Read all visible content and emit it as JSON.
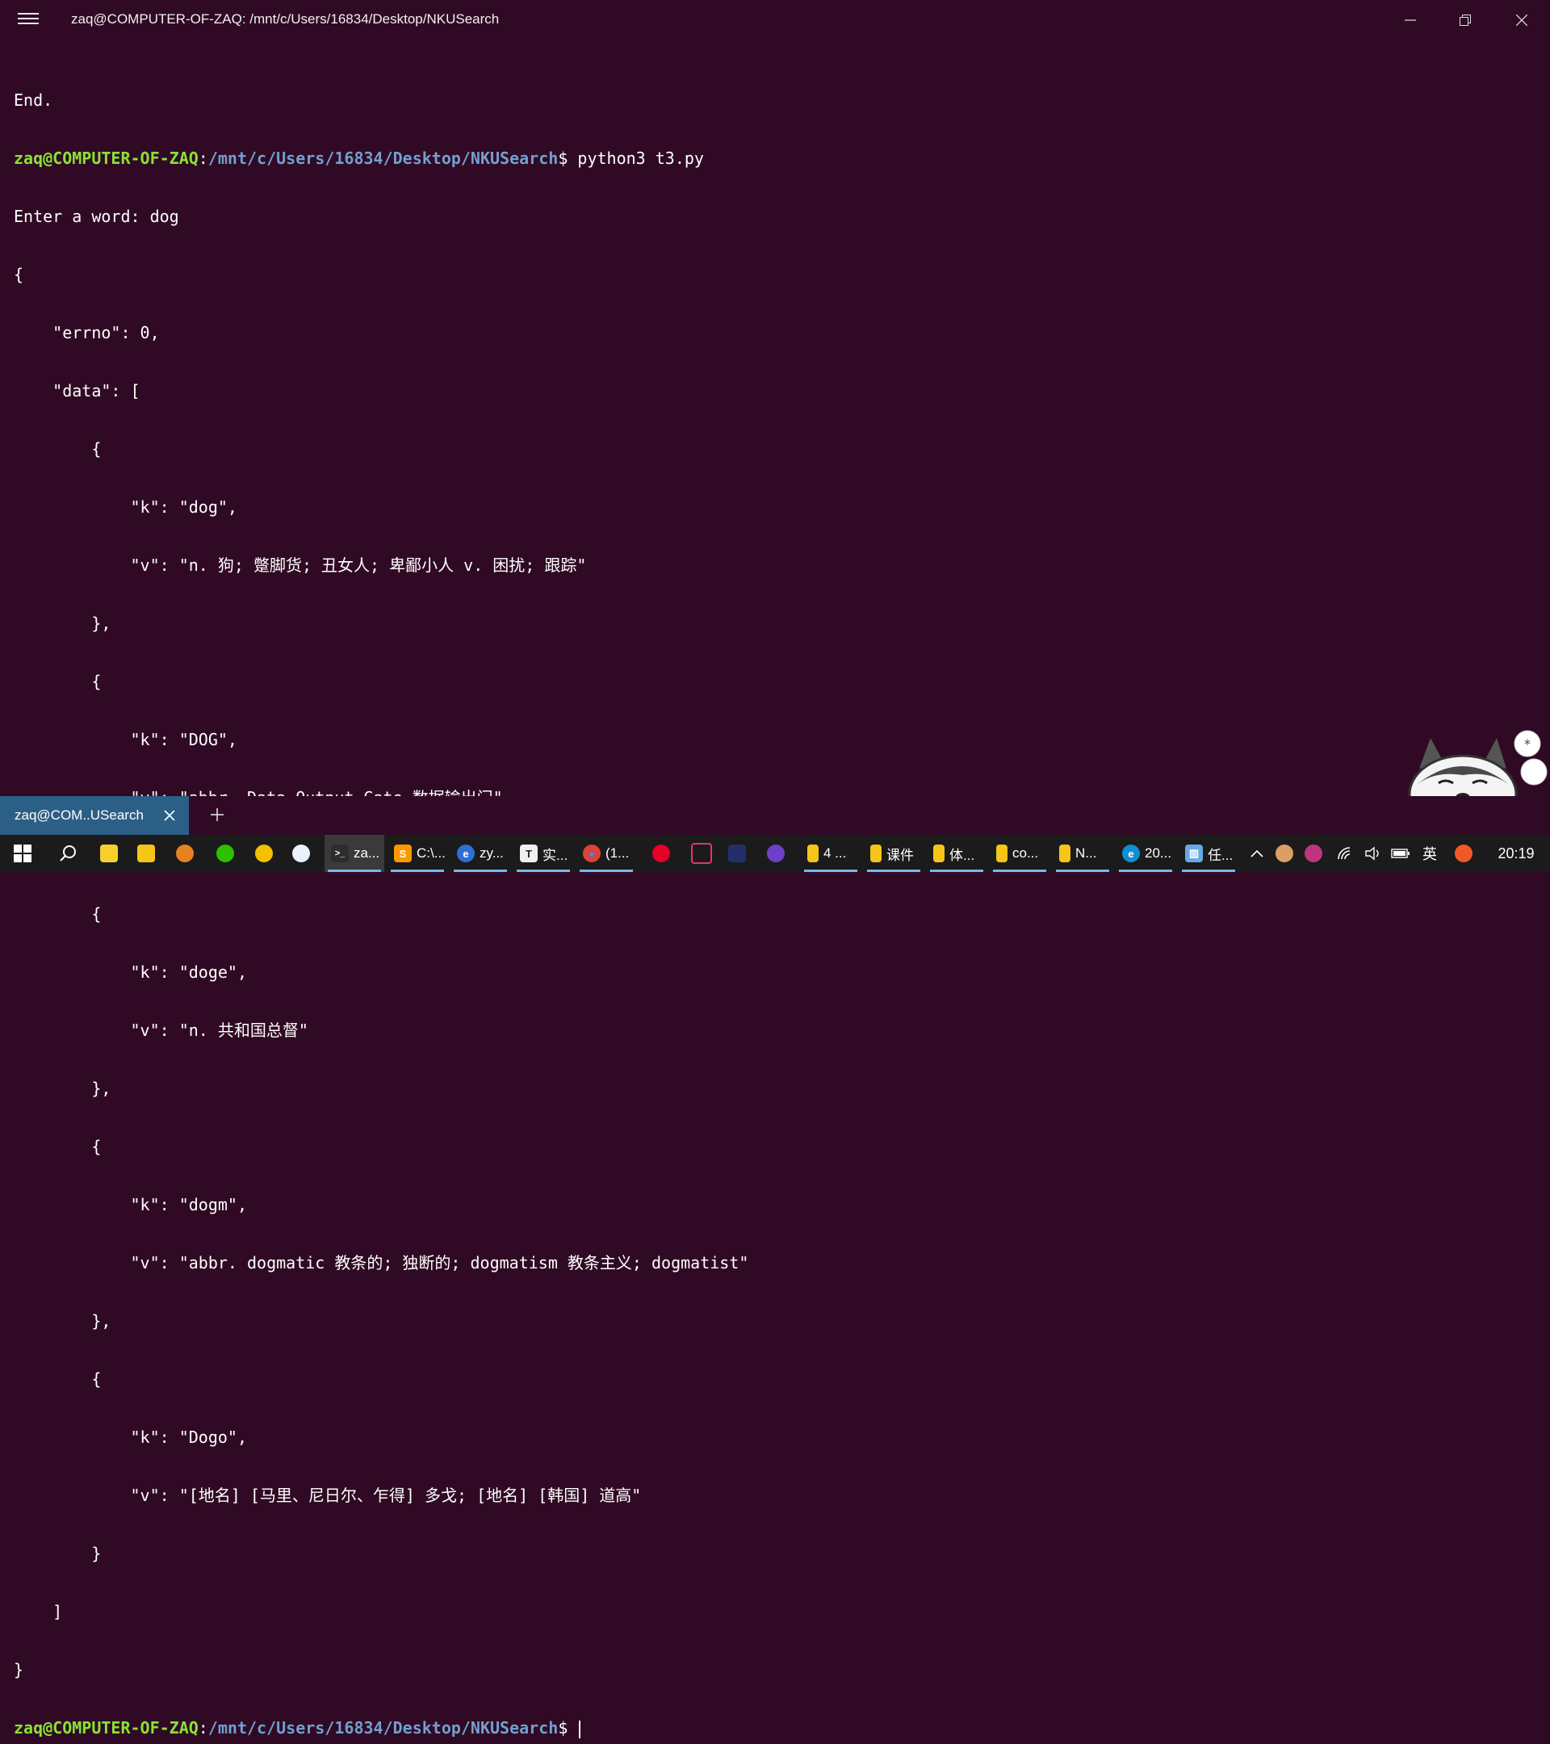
{
  "window": {
    "title": "zaq@COMPUTER-OF-ZAQ: /mnt/c/Users/16834/Desktop/NKUSearch"
  },
  "terminal": {
    "user_host": "zaq@COMPUTER-OF-ZAQ",
    "colon": ":",
    "path": "/mnt/c/Users/16834/Desktop/NKUSearch",
    "prompt_symbol": "$ ",
    "command": "python3 t3.py",
    "lines": [
      "End.",
      "Enter a word: dog",
      "{",
      "    \"errno\": 0,",
      "    \"data\": [",
      "        {",
      "            \"k\": \"dog\",",
      "            \"v\": \"n. 狗; 蹩脚货; 丑女人; 卑鄙小人 v. 困扰; 跟踪\"",
      "        },",
      "        {",
      "            \"k\": \"DOG\",",
      "            \"v\": \"abbr. Data Output Gate 数据输出门\"",
      "        },",
      "        {",
      "            \"k\": \"doge\",",
      "            \"v\": \"n. 共和国总督\"",
      "        },",
      "        {",
      "            \"k\": \"dogm\",",
      "            \"v\": \"abbr. dogmatic 教条的; 独断的; dogmatism 教条主义; dogmatist\"",
      "        },",
      "        {",
      "            \"k\": \"Dogo\",",
      "            \"v\": \"[地名] [马里、尼日尔、乍得] 多戈; [地名] [韩国] 道高\"",
      "        }",
      "    ]",
      "}"
    ]
  },
  "tabs": {
    "active_label": "zaq@COM..USearch"
  },
  "taskbar": {
    "apps": [
      {
        "label": "za...",
        "icon": "terminal-icon",
        "color": "#2d2d2d",
        "glyph": ">_"
      },
      {
        "label": "C:\\...",
        "icon": "sublime-icon",
        "color": "#ff9800",
        "glyph": "S"
      },
      {
        "label": "zy...",
        "icon": "browser-icon",
        "color": "#2f6fd6",
        "glyph": "e"
      },
      {
        "label": "实...",
        "icon": "typora-icon",
        "color": "#f0f0f0",
        "glyph": "T"
      },
      {
        "label": "(1...",
        "icon": "chrome-icon",
        "color": "#34a853",
        "glyph": "●"
      },
      {
        "label": "4 ...",
        "icon": "folder-icon",
        "color": "#f5c518",
        "glyph": ""
      },
      {
        "label": "课件",
        "icon": "folder-icon",
        "color": "#f5c518",
        "glyph": ""
      },
      {
        "label": "体...",
        "icon": "folder-icon",
        "color": "#f5c518",
        "glyph": ""
      },
      {
        "label": "co...",
        "icon": "folder-icon",
        "color": "#f5c518",
        "glyph": ""
      },
      {
        "label": "N...",
        "icon": "folder-icon",
        "color": "#f5c518",
        "glyph": ""
      },
      {
        "label": "20...",
        "icon": "edge-icon",
        "color": "#0c8fd6",
        "glyph": "e"
      },
      {
        "label": "任...",
        "icon": "task-manager-icon",
        "color": "#6aa9e9",
        "glyph": "▥"
      }
    ],
    "ime": "英",
    "time": "20:19"
  }
}
